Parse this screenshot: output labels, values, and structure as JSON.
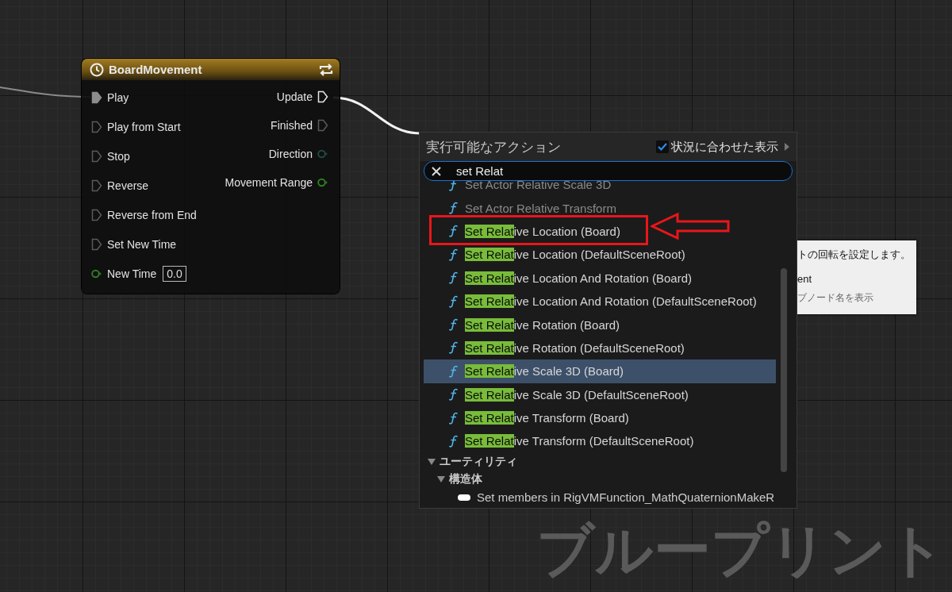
{
  "node": {
    "title": "BoardMovement",
    "inputs": [
      {
        "label": "Play",
        "kind": "exec",
        "connected": true
      },
      {
        "label": "Play from Start",
        "kind": "exec",
        "connected": false
      },
      {
        "label": "Stop",
        "kind": "exec",
        "connected": false
      },
      {
        "label": "Reverse",
        "kind": "exec",
        "connected": false
      },
      {
        "label": "Reverse from End",
        "kind": "exec",
        "connected": false
      },
      {
        "label": "Set New Time",
        "kind": "exec",
        "connected": false
      },
      {
        "label": "New Time",
        "kind": "data",
        "color": "#2f7d24",
        "value": "0.0"
      }
    ],
    "outputs": [
      {
        "label": "Update",
        "kind": "exec",
        "connected": true
      },
      {
        "label": "Finished",
        "kind": "exec",
        "connected": false
      },
      {
        "label": "Direction",
        "kind": "data",
        "color": "#1f4a44"
      },
      {
        "label": "Movement Range",
        "kind": "data",
        "color": "#2f7d24"
      }
    ]
  },
  "popup": {
    "title": "実行可能なアクション",
    "context_toggle": {
      "label": "状況に合わせた表示",
      "checked": true
    },
    "search": {
      "value": "set Relat"
    },
    "items": [
      {
        "text": "Set Actor Relative Scale 3D",
        "selected": false
      },
      {
        "text": "Set Actor Relative Transform",
        "selected": false
      },
      {
        "match": "Set Relat",
        "text": "ive Location (Board)",
        "selected": false
      },
      {
        "match": "Set Relat",
        "text": "ive Location (DefaultSceneRoot)",
        "selected": false
      },
      {
        "match": "Set Relat",
        "text": "ive Location And Rotation (Board)",
        "selected": false
      },
      {
        "match": "Set Relat",
        "text": "ive Location And Rotation (DefaultSceneRoot)",
        "selected": false
      },
      {
        "match": "Set Relat",
        "text": "ive Rotation (Board)",
        "selected": false
      },
      {
        "match": "Set Relat",
        "text": "ive Rotation (DefaultSceneRoot)",
        "selected": false
      },
      {
        "match": "Set Relat",
        "text": "ive Scale 3D (Board)",
        "selected": true
      },
      {
        "match": "Set Relat",
        "text": "ive Scale 3D (DefaultSceneRoot)",
        "selected": false
      },
      {
        "match": "Set Relat",
        "text": "ive Transform (Board)",
        "selected": false
      },
      {
        "match": "Set Relat",
        "text": "ive Transform (DefaultSceneRoot)",
        "selected": false
      }
    ],
    "categories": [
      {
        "label": "ユーティリティ",
        "expanded": true,
        "children": [
          {
            "label": "構造体",
            "expanded": true,
            "children": [
              {
                "label": "Set members in RigVMFunction_MathQuaternionMakeR"
              }
            ]
          }
        ]
      }
    ]
  },
  "tooltip": {
    "lines": [
      "トの回転を設定します。",
      "ent",
      "ブノード名を表示"
    ]
  },
  "graph_label": "ブループリント"
}
